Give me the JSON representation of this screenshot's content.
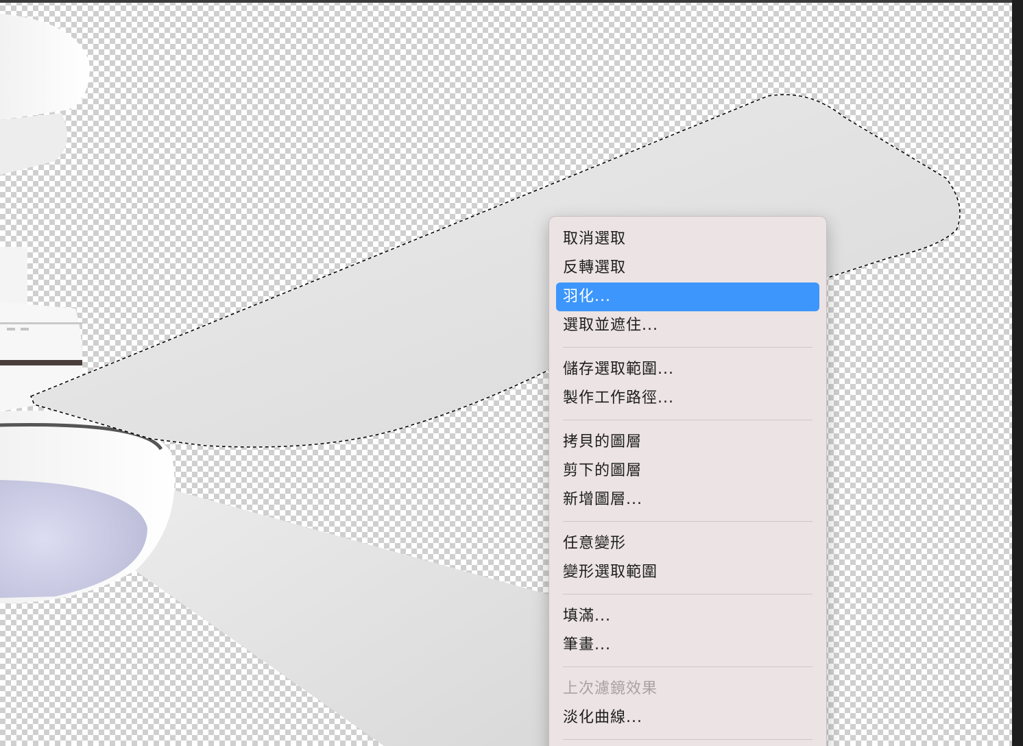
{
  "menu": {
    "items": [
      {
        "label": "取消選取",
        "state": "normal"
      },
      {
        "label": "反轉選取",
        "state": "normal"
      },
      {
        "label": "羽化...",
        "state": "selected"
      },
      {
        "label": "選取並遮住...",
        "state": "normal"
      },
      {
        "separator": true
      },
      {
        "label": "儲存選取範圍...",
        "state": "normal"
      },
      {
        "label": "製作工作路徑...",
        "state": "normal"
      },
      {
        "separator": true
      },
      {
        "label": "拷貝的圖層",
        "state": "normal"
      },
      {
        "label": "剪下的圖層",
        "state": "normal"
      },
      {
        "label": "新增圖層...",
        "state": "normal"
      },
      {
        "separator": true
      },
      {
        "label": "任意變形",
        "state": "normal"
      },
      {
        "label": "變形選取範圍",
        "state": "normal"
      },
      {
        "separator": true
      },
      {
        "label": "填滿...",
        "state": "normal"
      },
      {
        "label": "筆畫...",
        "state": "normal"
      },
      {
        "separator": true
      },
      {
        "label": "上次濾鏡效果",
        "state": "disabled"
      },
      {
        "label": "淡化曲線...",
        "state": "normal"
      },
      {
        "separator": true
      }
    ]
  },
  "colors": {
    "menu_background": "#ece3e4",
    "highlight": "#3d96fb",
    "disabled_text": "#a9a2a3"
  }
}
